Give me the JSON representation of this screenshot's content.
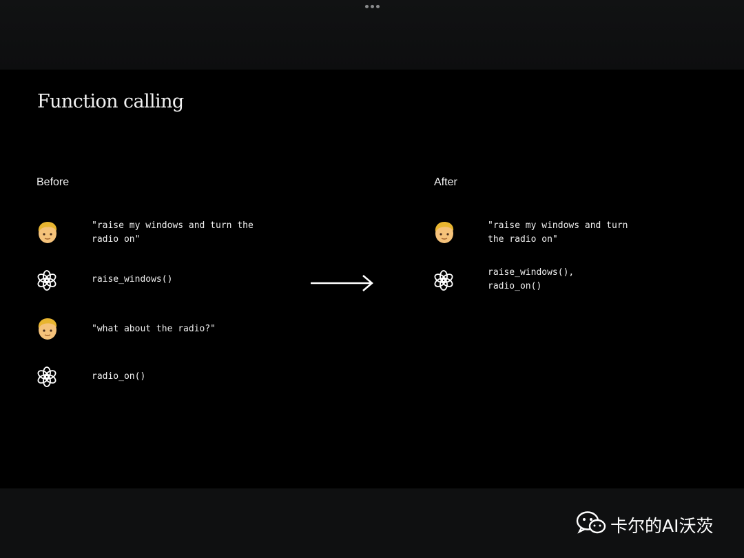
{
  "slide": {
    "title": "Function calling",
    "before": {
      "heading": "Before",
      "messages": [
        {
          "role": "user",
          "icon": "user-avatar-icon",
          "text": "\"raise my windows and turn the\nradio on\""
        },
        {
          "role": "assistant",
          "icon": "openai-logo-icon",
          "text": "raise_windows()"
        },
        {
          "role": "user",
          "icon": "user-avatar-icon",
          "text": "\"what about the radio?\""
        },
        {
          "role": "assistant",
          "icon": "openai-logo-icon",
          "text": "radio_on()"
        }
      ]
    },
    "after": {
      "heading": "After",
      "messages": [
        {
          "role": "user",
          "icon": "user-avatar-icon",
          "text": "\"raise my windows and turn\nthe radio on\""
        },
        {
          "role": "assistant",
          "icon": "openai-logo-icon",
          "text": "raise_windows(),\nradio_on()"
        }
      ]
    },
    "arrow_icon": "right-arrow-icon"
  },
  "watermark": {
    "text": "卡尔的AI沃茨",
    "icon": "wechat-icon"
  },
  "colors": {
    "slide_background": "#000000",
    "frame_background": "#0d0e0f",
    "text": "#f0f0f0"
  }
}
